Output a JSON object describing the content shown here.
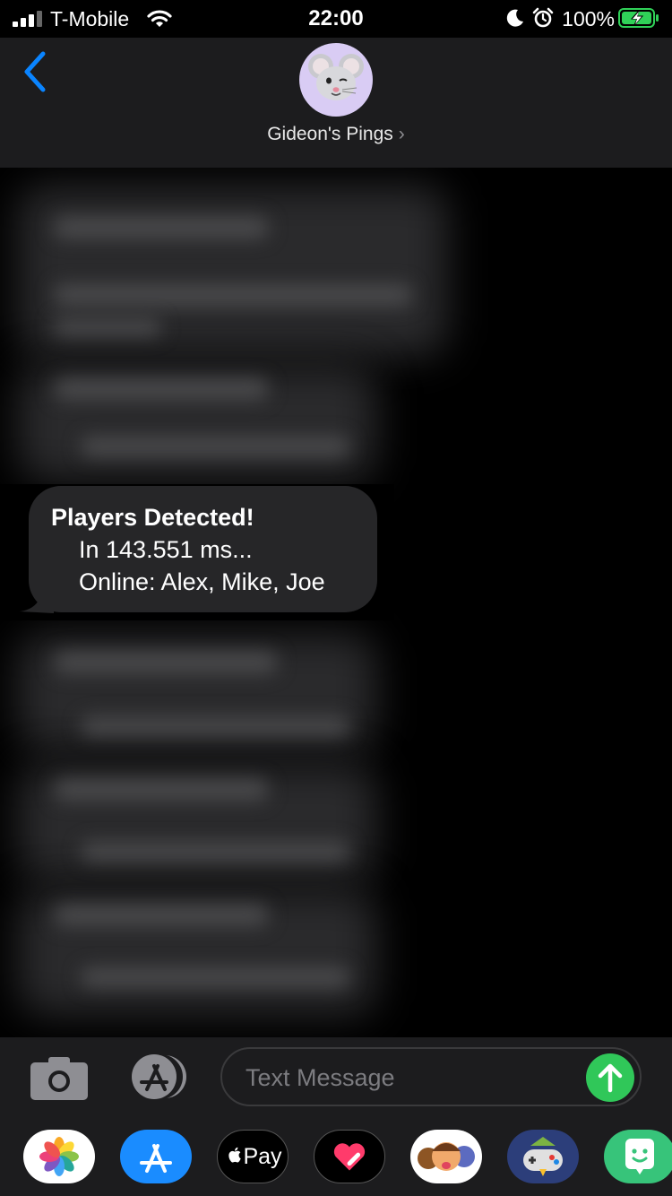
{
  "status_bar": {
    "carrier": "T-Mobile",
    "time": "22:00",
    "battery_percent": "100%"
  },
  "header": {
    "contact_name": "Gideon's Pings",
    "chevron": "›"
  },
  "message": {
    "title": "Players Detected!",
    "line1": "In 143.551 ms...",
    "line2": "Online: Alex, Mike, Joe"
  },
  "composer": {
    "placeholder": "Text Message"
  },
  "app_drawer": {
    "apple_pay_label": "Pay",
    "apps": [
      "photos-app-icon",
      "app-store-app-icon",
      "apple-pay-app-icon",
      "digital-touch-app-icon",
      "memoji-app-icon",
      "game-app-icon",
      "sticker-app-icon"
    ]
  },
  "colors": {
    "accent_blue": "#0a84ff",
    "send_green": "#30c759",
    "bubble_gray": "#262628",
    "bar_gray": "#1c1c1e",
    "avatar_lavender": "#d9ccf4",
    "battery_green": "#30d158"
  }
}
